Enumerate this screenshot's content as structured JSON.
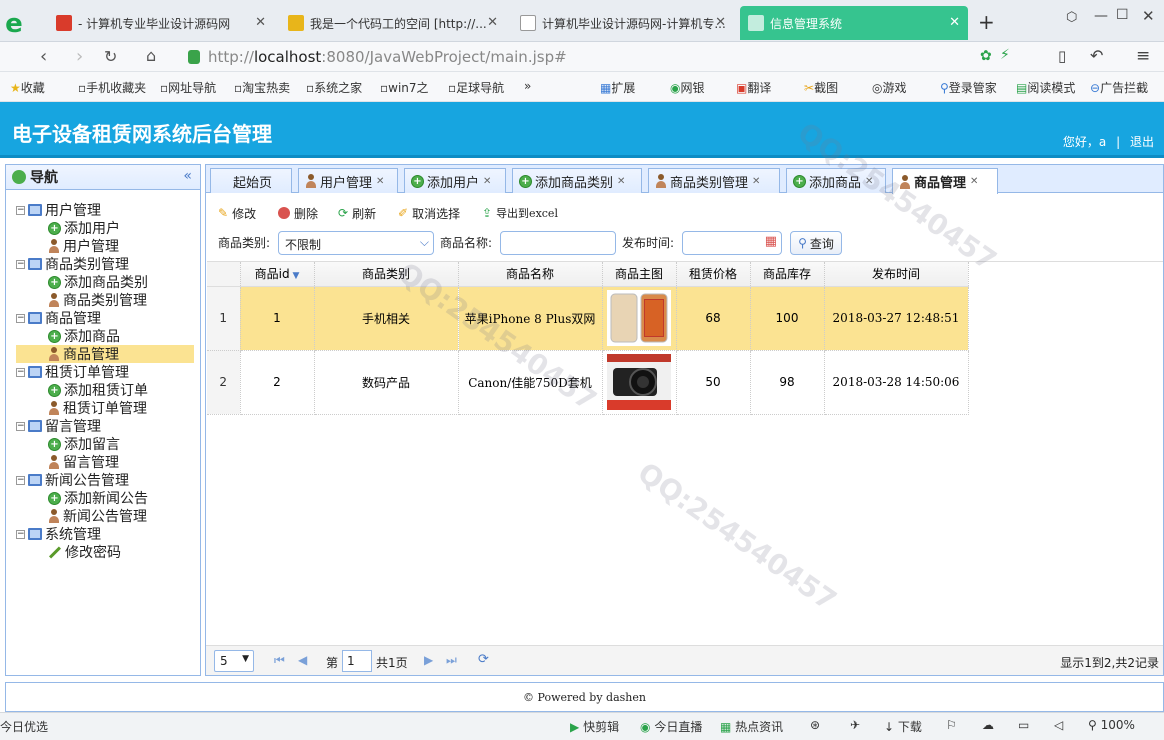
{
  "browser": {
    "tabs": [
      {
        "title": "- 计算机专业毕业设计源码网",
        "active": false
      },
      {
        "title": "我是一个代码工的空间 [http://...",
        "active": false
      },
      {
        "title": "计算机毕业设计源码网-计算机专...",
        "active": false
      },
      {
        "title": "信息管理系统",
        "active": true
      }
    ],
    "new_tab": "+",
    "url_prefix": "http://",
    "url_host": "localhost",
    "url_rest": ":8080/JavaWebProject/main.jsp#",
    "bookmarks": [
      "收藏",
      "手机收藏夹",
      "网址导航",
      "淘宝热卖",
      "系统之家",
      "win7之",
      "足球导航",
      "»"
    ],
    "extensions": [
      "扩展",
      "网银",
      "翻译",
      "截图",
      "游戏",
      "登录管家",
      "阅读模式",
      "广告拦截"
    ]
  },
  "app": {
    "title": "电子设备租赁网系统后台管理",
    "greeting": "您好，a",
    "separator": "|",
    "logout": "退出"
  },
  "sidebar": {
    "title": "导航",
    "collapse": "«",
    "groups": [
      {
        "label": "用户管理",
        "items": [
          "添加用户",
          "用户管理"
        ]
      },
      {
        "label": "商品类别管理",
        "items": [
          "添加商品类别",
          "商品类别管理"
        ]
      },
      {
        "label": "商品管理",
        "items": [
          "添加商品",
          "商品管理"
        ]
      },
      {
        "label": "租赁订单管理",
        "items": [
          "添加租赁订单",
          "租赁订单管理"
        ]
      },
      {
        "label": "留言管理",
        "items": [
          "添加留言",
          "留言管理"
        ]
      },
      {
        "label": "新闻公告管理",
        "items": [
          "添加新闻公告",
          "新闻公告管理"
        ]
      },
      {
        "label": "系统管理",
        "items": [
          "修改密码"
        ]
      }
    ]
  },
  "tabs": [
    "起始页",
    "用户管理",
    "添加用户",
    "添加商品类别",
    "商品类别管理",
    "添加商品",
    "商品管理"
  ],
  "toolbar": {
    "edit": "修改",
    "delete": "删除",
    "refresh": "刷新",
    "cancel_select": "取消选择",
    "export": "导出到excel"
  },
  "search": {
    "category_label": "商品类别:",
    "category_value": "不限制",
    "name_label": "商品名称:",
    "name_value": "",
    "time_label": "发布时间:",
    "time_value": "",
    "query": "查询"
  },
  "grid": {
    "columns": [
      "商品id",
      "商品类别",
      "商品名称",
      "商品主图",
      "租赁价格",
      "商品库存",
      "发布时间"
    ],
    "rows": [
      {
        "rn": "1",
        "id": "1",
        "category": "手机相关",
        "name": "苹果iPhone 8 Plus双网",
        "image": "iphone-photo",
        "price": "68",
        "stock": "100",
        "time": "2018-03-27 12:48:51"
      },
      {
        "rn": "2",
        "id": "2",
        "category": "数码产品",
        "name": "Canon/佳能750D套机",
        "image": "camera-photo",
        "price": "50",
        "stock": "98",
        "time": "2018-03-28 14:50:06"
      }
    ]
  },
  "pager": {
    "page_size": "5",
    "page_prefix": "第",
    "page_value": "1",
    "page_total": "共1页",
    "summary": "显示1到2,共2记录"
  },
  "footer": "© Powered by dashen",
  "statusbar": [
    "今日优选",
    "快剪辑",
    "今日直播",
    "热点资讯",
    "下载",
    "100%"
  ],
  "colors": {
    "header": "#17a5e0",
    "highlight": "#fbe392",
    "panel_border": "#95b8e7"
  }
}
